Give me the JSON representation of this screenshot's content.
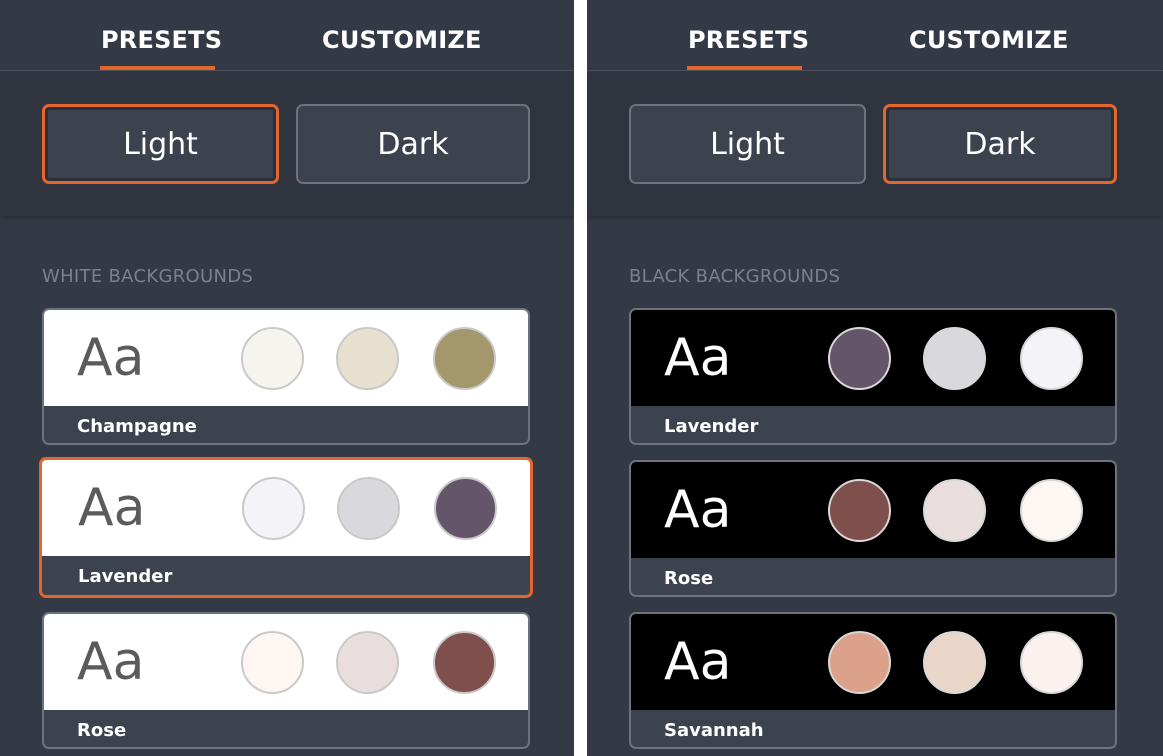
{
  "left_panel": {
    "tabs": [
      {
        "label": "PRESETS",
        "active": true
      },
      {
        "label": "CUSTOMIZE",
        "active": false
      }
    ],
    "modes": [
      {
        "label": "Light",
        "selected": true
      },
      {
        "label": "Dark",
        "selected": false
      }
    ],
    "section_label": "WHITE BACKGROUNDS",
    "cards": [
      {
        "sample": "Aa",
        "name": "Champagne",
        "selected": false,
        "swatches": [
          "#f6f4ee",
          "#e8e0cf",
          "#a4976c"
        ]
      },
      {
        "sample": "Aa",
        "name": "Lavender",
        "selected": true,
        "swatches": [
          "#f3f3f8",
          "#d8d8dd",
          "#655569"
        ]
      },
      {
        "sample": "Aa",
        "name": "Rose",
        "selected": false,
        "swatches": [
          "#fdf6f2",
          "#e9dedd",
          "#7e4f4b"
        ]
      }
    ]
  },
  "right_panel": {
    "tabs": [
      {
        "label": "PRESETS",
        "active": true
      },
      {
        "label": "CUSTOMIZE",
        "active": false
      }
    ],
    "modes": [
      {
        "label": "Light",
        "selected": false
      },
      {
        "label": "Dark",
        "selected": true
      }
    ],
    "section_label": "BLACK BACKGROUNDS",
    "cards": [
      {
        "sample": "Aa",
        "name": "Lavender",
        "selected": false,
        "swatches": [
          "#655569",
          "#d8d8dd",
          "#f3f3f8"
        ]
      },
      {
        "sample": "Aa",
        "name": "Rose",
        "selected": false,
        "swatches": [
          "#7e4f4b",
          "#e9dedd",
          "#fdf6f2"
        ]
      },
      {
        "sample": "Aa",
        "name": "Savannah",
        "selected": false,
        "swatches": [
          "#dca18a",
          "#ead5c9",
          "#fbf1ee"
        ]
      }
    ]
  },
  "colors": {
    "accent": "#e2662d",
    "panel_bg": "#343a45",
    "card_footer_bg": "#3d434e"
  }
}
